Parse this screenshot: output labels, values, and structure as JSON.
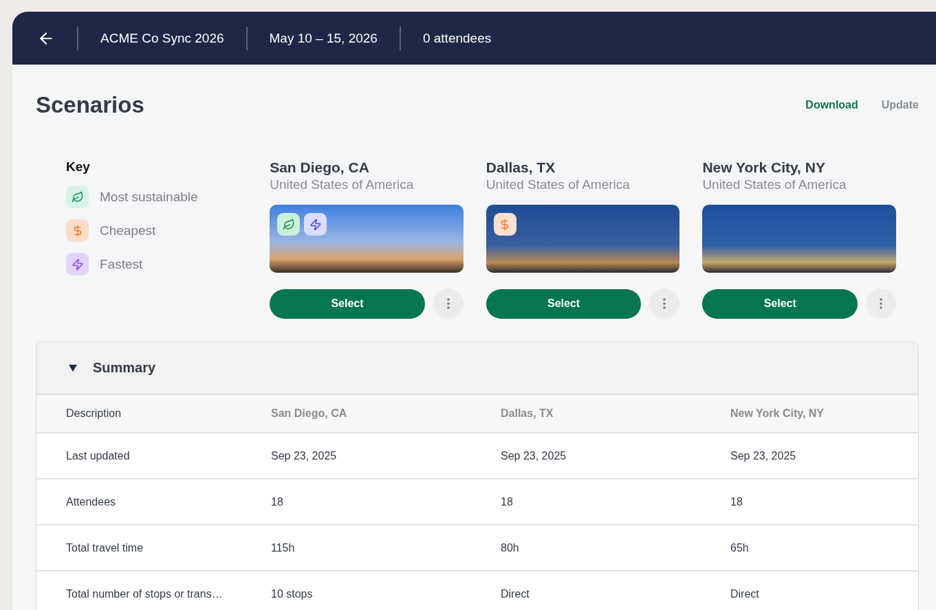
{
  "header": {
    "trip_name": "ACME Co Sync 2026",
    "dates": "May 10 – 15, 2026",
    "attendees": "0 attendees"
  },
  "page": {
    "title": "Scenarios",
    "actions": [
      "Download",
      "Update"
    ]
  },
  "key": {
    "title": "Key",
    "items": [
      {
        "kind": "sustainable",
        "label": "Most sustainable"
      },
      {
        "kind": "cheapest",
        "label": "Cheapest"
      },
      {
        "kind": "fastest",
        "label": "Fastest"
      }
    ]
  },
  "scenarios": [
    {
      "city": "San Diego, CA",
      "country": "United States of America",
      "sustainable": true,
      "cheapest": false,
      "fastest": true,
      "button": "Select"
    },
    {
      "city": "Dallas, TX",
      "country": "United States of America",
      "sustainable": false,
      "cheapest": true,
      "fastest": false,
      "button": "Select"
    },
    {
      "city": "New York City, NY",
      "country": "United States of America",
      "sustainable": false,
      "cheapest": false,
      "fastest": false,
      "button": "Select"
    }
  ],
  "summary": {
    "title": "Summary",
    "expanded": true,
    "columns": [
      "Description",
      "San Diego, CA",
      "Dallas, TX",
      "New York City, NY"
    ],
    "rows": [
      [
        "Last updated",
        "Sep 23, 2025",
        "Sep 23, 2025",
        "Sep 23, 2025"
      ],
      [
        "Attendees",
        "18",
        "18",
        "18"
      ],
      [
        "Total travel time",
        "115h",
        "80h",
        "65h"
      ],
      [
        "Total number of stops or trans…",
        "10 stops",
        "Direct",
        "Direct"
      ]
    ]
  }
}
